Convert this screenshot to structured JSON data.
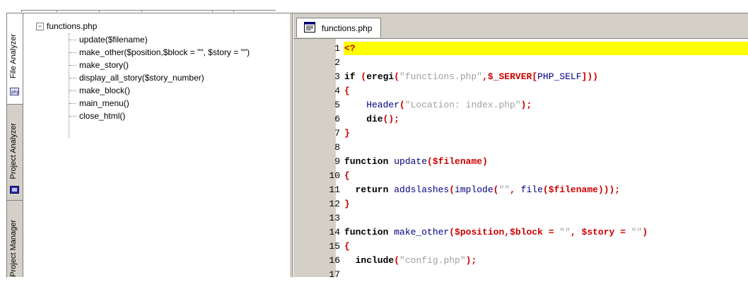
{
  "side_tabs": [
    {
      "label": "File Analyzer",
      "active": true,
      "icon": "php-file-icon"
    },
    {
      "label": "Project Analyzer",
      "active": false,
      "icon": "project-icon"
    },
    {
      "label": "Project Manager",
      "active": false,
      "icon": ""
    }
  ],
  "tree": {
    "root": "functions.php",
    "expander": "−",
    "items": [
      "update($filename)",
      "make_other($position,$block = \"\", $story = \"\")",
      "make_story()",
      "display_all_story($story_number)",
      "make_block()",
      "main_menu()",
      "close_html()"
    ]
  },
  "editor": {
    "tab_label": "functions.php",
    "highlight_color": "#ffff00",
    "lines": [
      {
        "n": "1",
        "segs": [
          {
            "c": "red",
            "t": "<?"
          }
        ]
      },
      {
        "n": "2",
        "segs": []
      },
      {
        "n": "3",
        "segs": [
          {
            "c": "kw",
            "t": "if "
          },
          {
            "c": "punc",
            "t": "("
          },
          {
            "c": "kw",
            "t": "eregi"
          },
          {
            "c": "punc",
            "t": "("
          },
          {
            "c": "str",
            "t": "\"functions.php\""
          },
          {
            "c": "punc",
            "t": ","
          },
          {
            "c": "var",
            "t": "$_SERVER"
          },
          {
            "c": "punc",
            "t": "["
          },
          {
            "c": "fn",
            "t": "PHP_SELF"
          },
          {
            "c": "punc",
            "t": "]))"
          }
        ]
      },
      {
        "n": "4",
        "segs": [
          {
            "c": "punc",
            "t": "{"
          }
        ]
      },
      {
        "n": "5",
        "segs": [
          {
            "c": "fn",
            "t": "    Header"
          },
          {
            "c": "punc",
            "t": "("
          },
          {
            "c": "str",
            "t": "\"Location: index.php\""
          },
          {
            "c": "punc",
            "t": ");"
          }
        ]
      },
      {
        "n": "6",
        "segs": [
          {
            "c": "kw",
            "t": "    die"
          },
          {
            "c": "punc",
            "t": "();"
          }
        ]
      },
      {
        "n": "7",
        "segs": [
          {
            "c": "punc",
            "t": "}"
          }
        ]
      },
      {
        "n": "8",
        "segs": []
      },
      {
        "n": "9",
        "segs": [
          {
            "c": "kw",
            "t": "function "
          },
          {
            "c": "fn",
            "t": "update"
          },
          {
            "c": "punc",
            "t": "("
          },
          {
            "c": "var",
            "t": "$filename"
          },
          {
            "c": "punc",
            "t": ")"
          }
        ]
      },
      {
        "n": "10",
        "segs": [
          {
            "c": "punc",
            "t": "{"
          }
        ]
      },
      {
        "n": "11",
        "segs": [
          {
            "c": "kw",
            "t": "  return "
          },
          {
            "c": "fn",
            "t": "addslashes"
          },
          {
            "c": "punc",
            "t": "("
          },
          {
            "c": "fn",
            "t": "implode"
          },
          {
            "c": "punc",
            "t": "("
          },
          {
            "c": "str",
            "t": "\"\""
          },
          {
            "c": "punc",
            "t": ", "
          },
          {
            "c": "fn",
            "t": "file"
          },
          {
            "c": "punc",
            "t": "("
          },
          {
            "c": "var",
            "t": "$filename"
          },
          {
            "c": "punc",
            "t": ")));"
          }
        ]
      },
      {
        "n": "12",
        "segs": [
          {
            "c": "punc",
            "t": "}"
          }
        ]
      },
      {
        "n": "13",
        "segs": []
      },
      {
        "n": "14",
        "segs": [
          {
            "c": "kw",
            "t": "function "
          },
          {
            "c": "fn",
            "t": "make_other"
          },
          {
            "c": "punc",
            "t": "("
          },
          {
            "c": "var",
            "t": "$position"
          },
          {
            "c": "punc",
            "t": ","
          },
          {
            "c": "var",
            "t": "$block"
          },
          {
            "c": "punc",
            "t": " = "
          },
          {
            "c": "str",
            "t": "\"\""
          },
          {
            "c": "punc",
            "t": ", "
          },
          {
            "c": "var",
            "t": "$story"
          },
          {
            "c": "punc",
            "t": " = "
          },
          {
            "c": "str",
            "t": "\"\""
          },
          {
            "c": "punc",
            "t": ")"
          }
        ]
      },
      {
        "n": "15",
        "segs": [
          {
            "c": "punc",
            "t": "{"
          }
        ]
      },
      {
        "n": "16",
        "segs": [
          {
            "c": "kw",
            "t": "  include"
          },
          {
            "c": "punc",
            "t": "("
          },
          {
            "c": "str",
            "t": "\"config.php\""
          },
          {
            "c": "punc",
            "t": ");"
          }
        ]
      },
      {
        "n": "17",
        "segs": []
      }
    ]
  }
}
